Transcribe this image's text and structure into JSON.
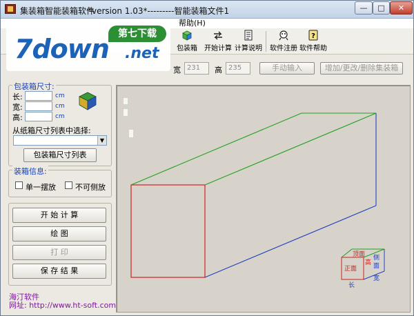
{
  "window": {
    "title": "集装箱智能装箱软件",
    "version_title": "*version 1.03*---------智能装箱文件1",
    "min_glyph": "—",
    "max_glyph": "□",
    "close_glyph": "✕"
  },
  "menu": {
    "help": "帮助(H)"
  },
  "toolbar": {
    "items": [
      {
        "label": "包装箱",
        "icon": "box-icon"
      },
      {
        "label": "开始计算",
        "icon": "calculate-icon"
      },
      {
        "label": "计算说明",
        "icon": "document-icon"
      },
      {
        "label": "软件注册",
        "icon": "register-icon"
      },
      {
        "label": "软件帮助",
        "icon": "help-icon"
      }
    ]
  },
  "watermark": {
    "main": "7down",
    "suffix": ".net",
    "badge": "第七下载"
  },
  "container": {
    "width_label": "宽",
    "width_value": "231",
    "height_label": "高",
    "height_value": "235",
    "manual_button": "手动输入",
    "manage_button": "增加/更改/删除集装箱"
  },
  "package": {
    "group_title": "包装箱尺寸:",
    "length_label": "长:",
    "width_label": "宽:",
    "height_label": "高:",
    "length_value": "",
    "width_value": "",
    "height_value": "",
    "unit": "cm",
    "select_prompt": "从纸箱尺寸列表中选择:",
    "select_value": "",
    "list_button": "包装箱尺寸列表"
  },
  "packing_info": {
    "group_title": "装箱信息:",
    "single_label": "单一摆放",
    "single_checked": false,
    "no_side_label": "不可侧放",
    "no_side_checked": false
  },
  "actions": {
    "start": "开 始 计 算",
    "draw": "绘    图",
    "print": "打    印",
    "save": "保 存 结 果"
  },
  "footer": {
    "company": "海汀软件",
    "url": "网址: http://www.ht-soft.com"
  },
  "legend": {
    "top": "顶面",
    "front": "正面",
    "side": "侧面",
    "height": "高",
    "length": "长",
    "width": "宽"
  },
  "colors": {
    "front_face": "#d02020",
    "top_edges": "#20a020",
    "side_edges": "#2040c0",
    "group_title": "#1a3fb0",
    "footer": "#7a1a9a"
  }
}
